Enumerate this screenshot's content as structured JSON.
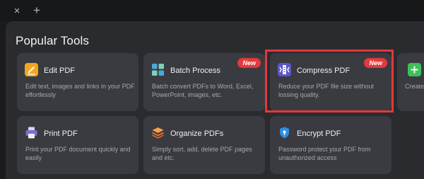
{
  "tabbar": {
    "close_glyph": "✕",
    "add_glyph": "+"
  },
  "section": {
    "title": "Popular Tools"
  },
  "cards": {
    "edit": {
      "title": "Edit PDF",
      "desc": "Edit text, images and links in your PDF effortlessly",
      "icon": "pencil-icon"
    },
    "batch": {
      "title": "Batch Process",
      "desc": "Batch convert PDFs to Word, Excel, PowerPoint, images, etc.",
      "badge": "New",
      "icon": "grid-icon"
    },
    "compress": {
      "title": "Compress PDF",
      "desc": "Reduce your PDF file size without lossing quality.",
      "badge": "New",
      "icon": "compress-icon"
    },
    "create": {
      "desc": "Create"
    },
    "print": {
      "title": "Print PDF",
      "desc": "Print your PDF document quickly and easily",
      "icon": "printer-icon"
    },
    "organize": {
      "title": "Organize PDFs",
      "desc": "Simply sort, add, delete PDF pages and etc.",
      "icon": "layers-icon"
    },
    "encrypt": {
      "title": "Encrypt PDF",
      "desc": "Password protect your PDF from unauthorized access",
      "icon": "shield-icon"
    }
  },
  "colors": {
    "badge": "#e23a3e",
    "highlight": "#e0393d",
    "edit_icon": "#f2a51f",
    "batch_icon": "#4aa9d8",
    "compress_icon": "#5a57c9",
    "create_icon": "#3fbf5a",
    "print_icon": "#7a6fc9",
    "organize_icon": "#f07a2c",
    "encrypt_icon": "#2f8fe0"
  }
}
